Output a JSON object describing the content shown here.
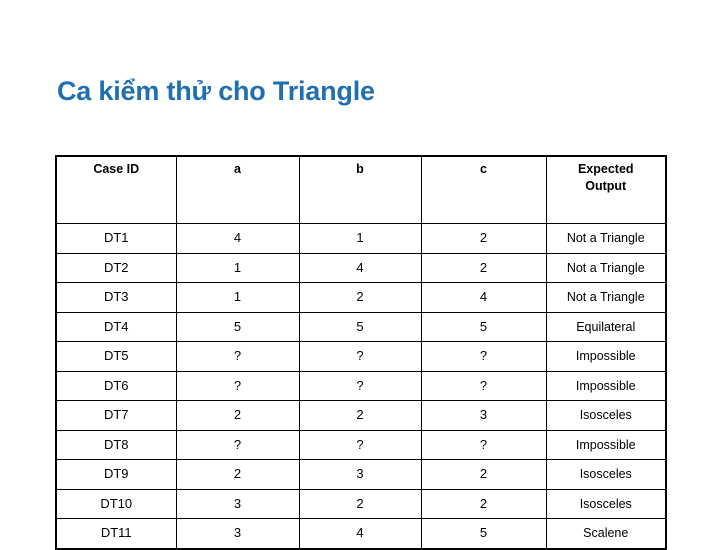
{
  "slide": {
    "title": "Ca kiểm thử cho Triangle",
    "title_color": "#1F6FB2",
    "background_color": "#FFFFFF"
  },
  "table": {
    "headers": {
      "case_id": "Case ID",
      "a": "a",
      "b": "b",
      "c": "c",
      "expected_output_line1": "Expected",
      "expected_output_line2": "Output"
    },
    "rows": [
      {
        "case_id": "DT1",
        "a": "4",
        "b": "1",
        "c": "2",
        "expected": "Not a Triangle"
      },
      {
        "case_id": "DT2",
        "a": "1",
        "b": "4",
        "c": "2",
        "expected": "Not a Triangle"
      },
      {
        "case_id": "DT3",
        "a": "1",
        "b": "2",
        "c": "4",
        "expected": "Not a Triangle"
      },
      {
        "case_id": "DT4",
        "a": "5",
        "b": "5",
        "c": "5",
        "expected": "Equilateral"
      },
      {
        "case_id": "DT5",
        "a": "?",
        "b": "?",
        "c": "?",
        "expected": "Impossible"
      },
      {
        "case_id": "DT6",
        "a": "?",
        "b": "?",
        "c": "?",
        "expected": "Impossible"
      },
      {
        "case_id": "DT7",
        "a": "2",
        "b": "2",
        "c": "3",
        "expected": "Isosceles"
      },
      {
        "case_id": "DT8",
        "a": "?",
        "b": "?",
        "c": "?",
        "expected": "Impossible"
      },
      {
        "case_id": "DT9",
        "a": "2",
        "b": "3",
        "c": "2",
        "expected": "Isosceles"
      },
      {
        "case_id": "DT10",
        "a": "3",
        "b": "2",
        "c": "2",
        "expected": "Isosceles"
      },
      {
        "case_id": "DT11",
        "a": "3",
        "b": "4",
        "c": "5",
        "expected": "Scalene"
      }
    ]
  }
}
